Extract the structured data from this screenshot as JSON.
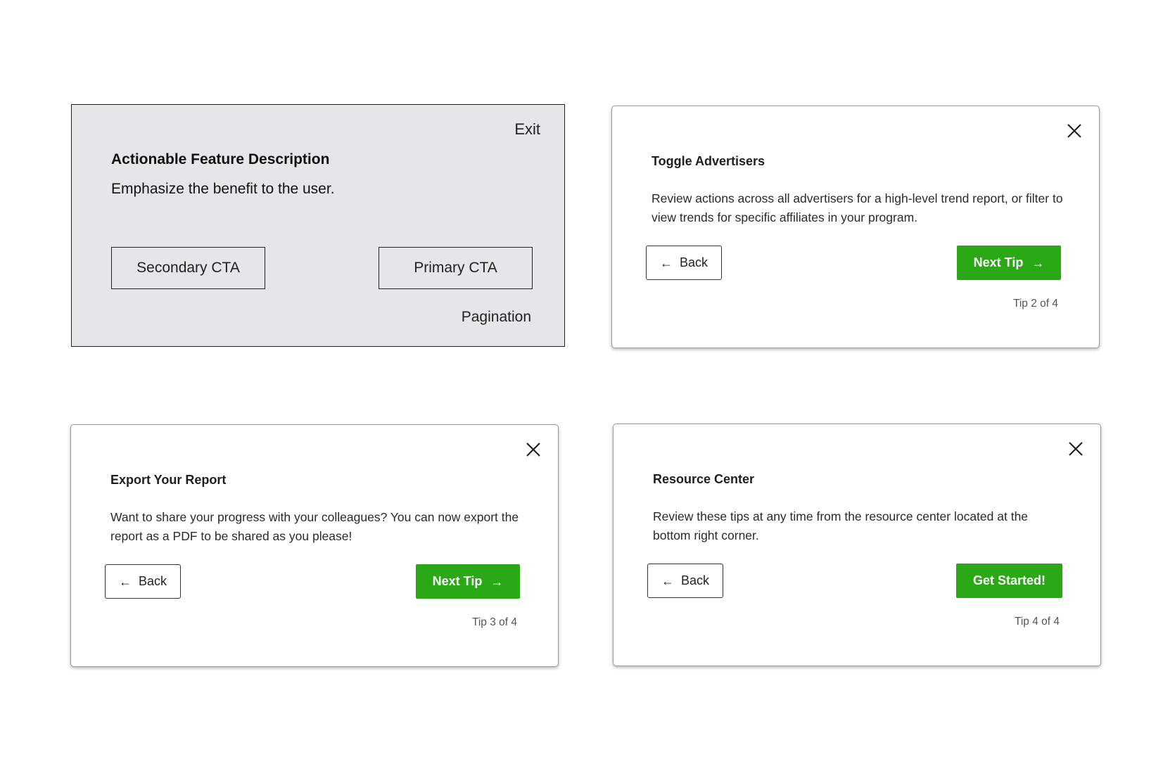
{
  "wireframe": {
    "exit_label": "Exit",
    "title": "Actionable Feature Description",
    "description": "Emphasize the benefit to the user.",
    "secondary_cta": "Secondary CTA",
    "primary_cta": "Primary CTA",
    "pagination": "Pagination"
  },
  "cards": [
    {
      "title": "Toggle Advertisers",
      "body": "Review actions across all advertisers for a high-level trend report, or filter to view trends for specific affiliates in your program.",
      "back_label": "Back",
      "next_label": "Next Tip",
      "counter": "Tip 2 of 4"
    },
    {
      "title": "Export Your Report",
      "body": "Want to share your progress with your colleagues? You can now export the report as a PDF to be shared as you please!",
      "back_label": "Back",
      "next_label": "Next Tip",
      "counter": "Tip 3 of 4"
    },
    {
      "title": "Resource Center",
      "body": "Review these tips at any time from the resource center located at the bottom right corner.",
      "back_label": "Back",
      "next_label": "Get Started!",
      "counter": "Tip 4 of 4"
    }
  ],
  "icons": {
    "back": "left-arrow-icon",
    "next": "right-arrow-icon",
    "close": "close-icon"
  },
  "colors": {
    "primary_green": "#2aa815",
    "wireframe_bg": "#e5e6e8"
  }
}
